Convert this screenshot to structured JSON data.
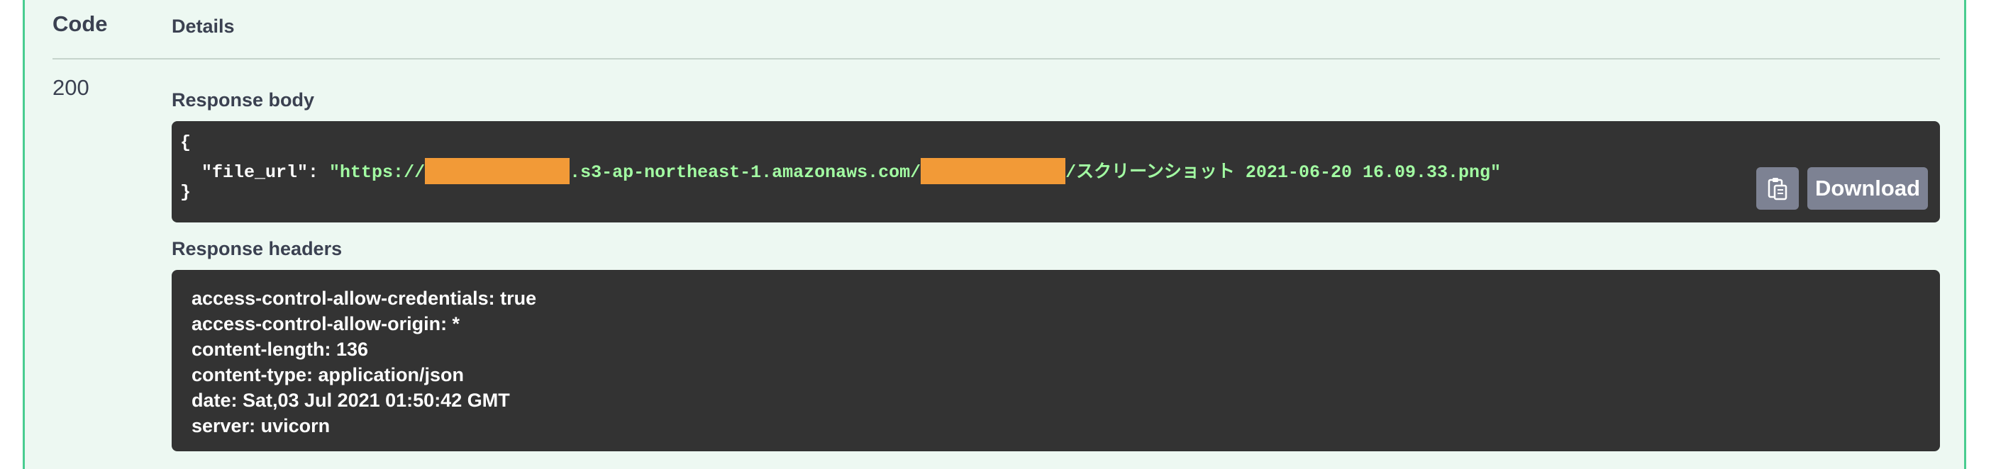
{
  "table_header": {
    "code_label": "Code",
    "details_label": "Details"
  },
  "response": {
    "code": "200",
    "body_title": "Response body",
    "body_lines": {
      "open_brace": "{",
      "key": "  \"file_url\": ",
      "url_prefix": "\"https://",
      "url_middle": ".s3-ap-northeast-1.amazonaws.com/",
      "url_suffix": "/スクリーンショット 2021-06-20 16.09.33.png\"",
      "close_brace": "}"
    },
    "redaction_color": "#f29a37",
    "copy_button_icon": "clipboard-icon",
    "download_label": "Download",
    "headers_title": "Response headers",
    "headers": [
      "access-control-allow-credentials: true",
      "access-control-allow-origin: *",
      "content-length: 136",
      "content-type: application/json",
      "date: Sat,03 Jul 2021 01:50:42 GMT",
      "server: uvicorn"
    ]
  },
  "colors": {
    "panel_bg": "#edf8f2",
    "panel_border": "#49cc90",
    "code_bg": "#333333",
    "string_color": "#a2fca2",
    "button_bg": "#7d8293",
    "text": "#3b4151"
  }
}
